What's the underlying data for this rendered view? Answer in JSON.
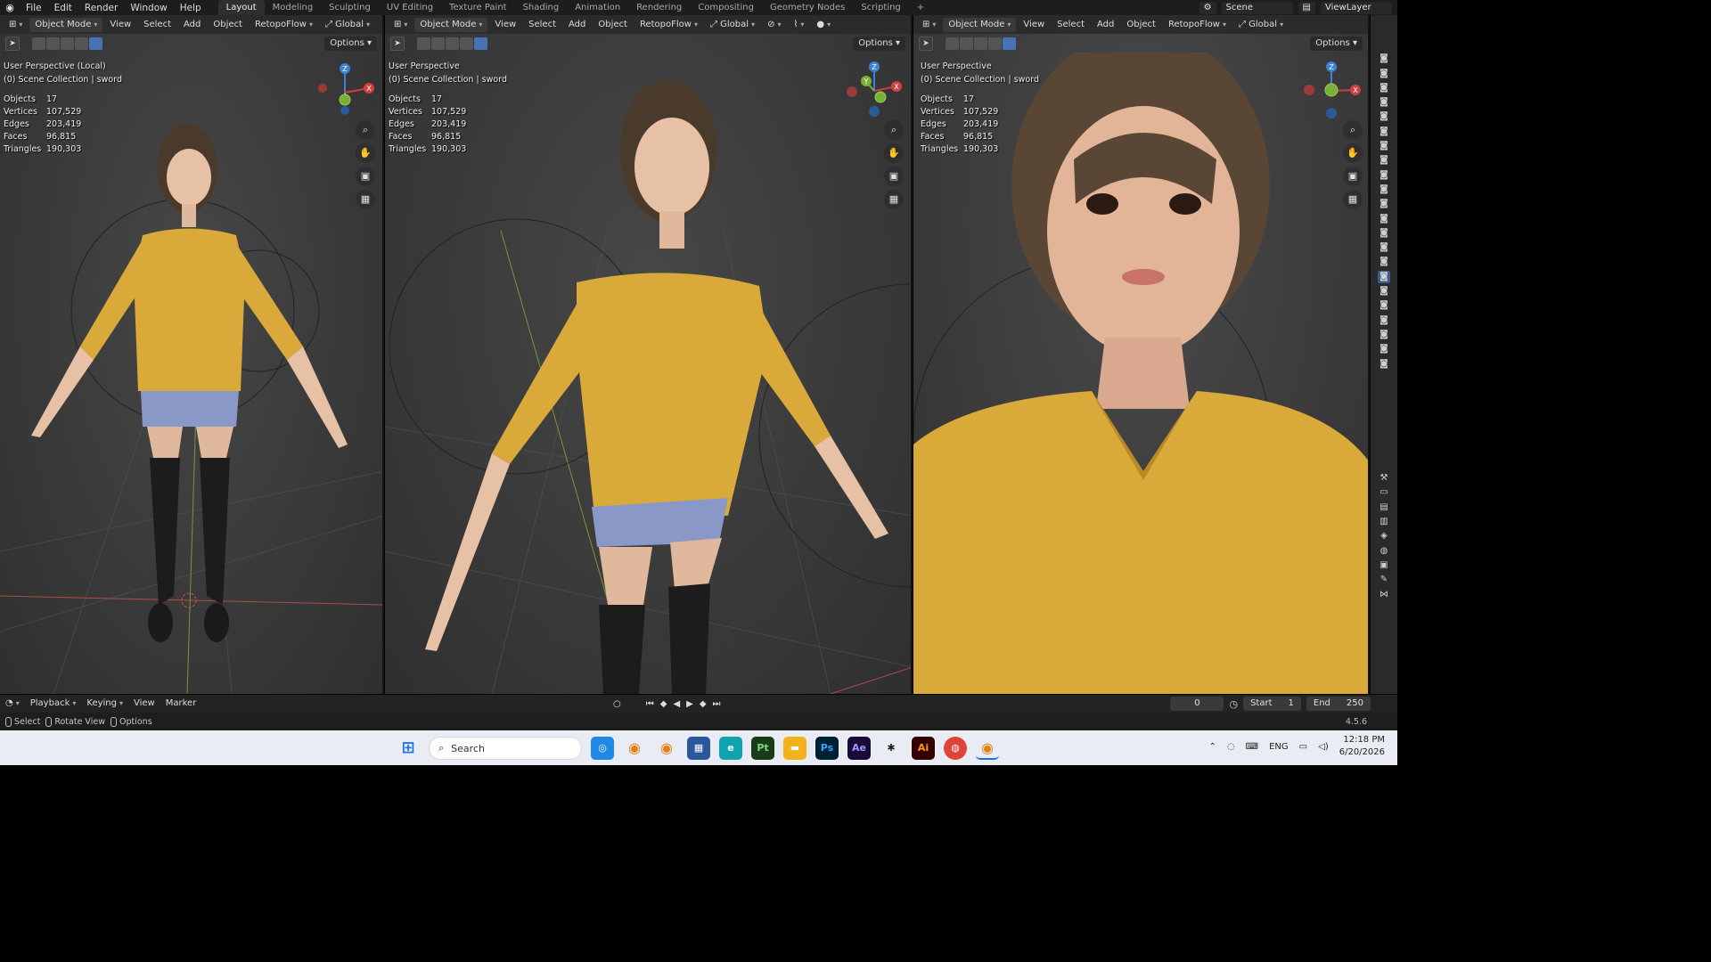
{
  "app": {
    "menus": [
      "File",
      "Edit",
      "Render",
      "Window",
      "Help"
    ],
    "workspaces": [
      "Layout",
      "Modeling",
      "Sculpting",
      "UV Editing",
      "Texture Paint",
      "Shading",
      "Animation",
      "Rendering",
      "Compositing",
      "Geometry Nodes",
      "Scripting"
    ],
    "active_workspace": "Layout",
    "scene": "Scene",
    "view_layer": "ViewLayer"
  },
  "viewport_header": {
    "mode": "Object Mode",
    "menus": [
      "View",
      "Select",
      "Add",
      "Object"
    ],
    "addon": "RetopoFlow",
    "orientation": "Global",
    "options": "Options"
  },
  "viewports": [
    {
      "perspective": "User Perspective (Local)",
      "collection": "(0) Scene Collection | sword",
      "stats": {
        "Objects": "17",
        "Vertices": "107,529",
        "Edges": "203,419",
        "Faces": "96,815",
        "Triangles": "190,303"
      }
    },
    {
      "perspective": "User Perspective",
      "collection": "(0) Scene Collection | sword",
      "stats": {
        "Objects": "17",
        "Vertices": "107,529",
        "Edges": "203,419",
        "Faces": "96,815",
        "Triangles": "190,303"
      }
    },
    {
      "perspective": "User Perspective",
      "collection": "(0) Scene Collection | sword",
      "stats": {
        "Objects": "17",
        "Vertices": "107,529",
        "Edges": "203,419",
        "Faces": "96,815",
        "Triangles": "190,303"
      }
    }
  ],
  "stat_labels": [
    "Objects",
    "Vertices",
    "Edges",
    "Faces",
    "Triangles"
  ],
  "gizmo_labels": {
    "x": "X",
    "y": "Y",
    "z": "Z"
  },
  "timeline": {
    "menus": [
      "Playback",
      "Keying",
      "View",
      "Marker"
    ],
    "current_frame": "0",
    "start_label": "Start",
    "start": "1",
    "end_label": "End",
    "end": "250"
  },
  "statusbar": {
    "select": "Select",
    "rotate": "Rotate View",
    "options": "Options",
    "version": "4.5.6"
  },
  "taskbar": {
    "search_placeholder": "Search",
    "lang": "ENG",
    "time": "12:18 PM",
    "date": "6/20/2026",
    "apps": [
      "Pt",
      "Ps",
      "Ae",
      "Ai"
    ]
  },
  "colors": {
    "sweater": "#d9a93a",
    "shorts": "#8a98c8",
    "skin": "#e7c1a6",
    "hair": "#4a3a2c",
    "active_blue": "#4772b3"
  }
}
